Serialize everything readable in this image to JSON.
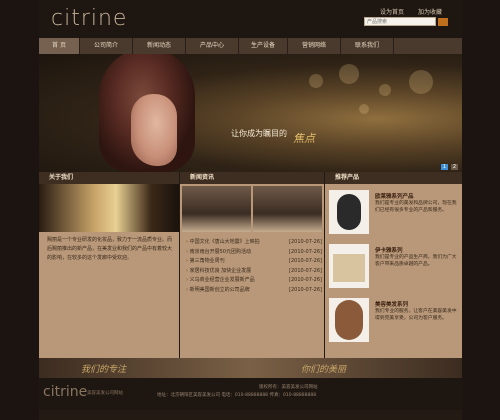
{
  "header": {
    "logo": "citrine",
    "links": [
      "设为首页",
      "加为收藏"
    ],
    "search_placeholder": "产品搜索"
  },
  "nav": [
    "首 页",
    "公司简介",
    "新闻动态",
    "产品中心",
    "生产设备",
    "营销网络",
    "联系我们"
  ],
  "banner": {
    "slogan": "让你成为瞩目的",
    "slogan_highlight": "焦点",
    "pages": [
      "1",
      "2"
    ]
  },
  "about": {
    "title": "关于我们",
    "text": "赐丽是一个专业研发的化妆品，致力于一流品质专业。而后赐丽推出的新产品，在美发业和我们的产品中有着较大的影响，在较多的这个发廊中受欢迎。"
  },
  "news": {
    "title": "新闻资讯",
    "items": [
      {
        "title": "中国文化《唐山大地震》上映拍",
        "date": "[2010-07-26]"
      },
      {
        "title": "南京雨台开展50元团购活动",
        "date": "[2010-07-26]"
      },
      {
        "title": "第三角物业周刊",
        "date": "[2010-07-26]"
      },
      {
        "title": "家居科技优良 加快企业发展",
        "date": "[2010-07-26]"
      },
      {
        "title": "义乌商业经营企业发展新产品",
        "date": "[2010-07-26]"
      },
      {
        "title": "新明美国新创立的公司品牌",
        "date": "[2010-07-26]"
      }
    ]
  },
  "products": {
    "title": "推荐产品",
    "items": [
      {
        "name": "欧莱雅系列产品",
        "desc": "我们是专业的美发和品牌公司，现在我们已经有很多专业的产品和服务。"
      },
      {
        "name": "伊卡雅系列",
        "desc": "我们是专业的产品生产商，我们为广大客户带来品质卓越的产品。"
      },
      {
        "name": "美容美发系列",
        "desc": "我们专业的服务，让客户在美容美发中得到完美享受，公司为客户服务。"
      }
    ]
  },
  "bands": {
    "left": "我们的专注",
    "right": "你们的美丽"
  },
  "footer": {
    "logo": "citrine",
    "sub": "美容美发公司网站",
    "line1": "版权所有：美容美发公司网站",
    "line2": "地址：北京朝阳区美容美发公司  电话：010-88888888  传真：010-88888888"
  }
}
